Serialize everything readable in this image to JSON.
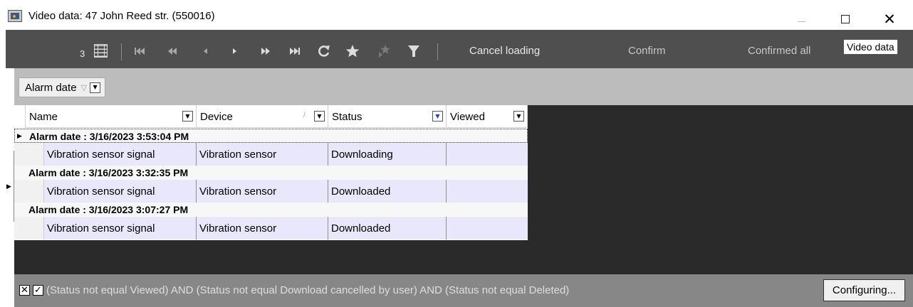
{
  "window": {
    "title": "Video data: 47 John Reed str. (550016)",
    "minimize": "",
    "maximize": "",
    "close": "✕"
  },
  "toolbar": {
    "record_count": "3",
    "cancel_loading": "Cancel loading",
    "confirm": "Confirm",
    "confirmed_all": "Confirmed all",
    "tooltip": "Video data",
    "icons": [
      "grid-view-icon",
      "first-page-icon",
      "previous-page-icon",
      "previous-icon",
      "next-icon",
      "next-page-icon",
      "last-page-icon",
      "refresh-icon",
      "star-icon",
      "star-outline-icon",
      "filter-icon"
    ]
  },
  "group_panel": {
    "group_label": "Alarm date"
  },
  "grid": {
    "columns": [
      "Name",
      "Device",
      "Status",
      "Viewed"
    ],
    "groups": [
      {
        "label": "Alarm date : 3/16/2023 3:53:04 PM",
        "rows": [
          {
            "name": "Vibration sensor signal",
            "device": "Vibration sensor",
            "status": "Downloading",
            "viewed": ""
          }
        ]
      },
      {
        "label": "Alarm date : 3/16/2023 3:32:35 PM",
        "rows": [
          {
            "name": "Vibration sensor signal",
            "device": "Vibration sensor",
            "status": "Downloaded",
            "viewed": ""
          }
        ]
      },
      {
        "label": "Alarm date : 3/16/2023 3:07:27 PM",
        "rows": [
          {
            "name": "Vibration sensor signal",
            "device": "Vibration sensor",
            "status": "Downloaded",
            "viewed": ""
          }
        ]
      }
    ]
  },
  "footer": {
    "filter_text": "(Status not equal Viewed) AND (Status not equal Download cancelled by user) AND (Status not equal Deleted)",
    "configure_button": "Configuring...",
    "clear_filter_glyph": "✕",
    "enable_filter_glyph": "✓"
  },
  "colors": {
    "toolbar_bg": "#4f4f4f",
    "main_bg": "#2a2a2a",
    "row_bg": "#e8e7fb",
    "footer_bg": "#878787"
  }
}
